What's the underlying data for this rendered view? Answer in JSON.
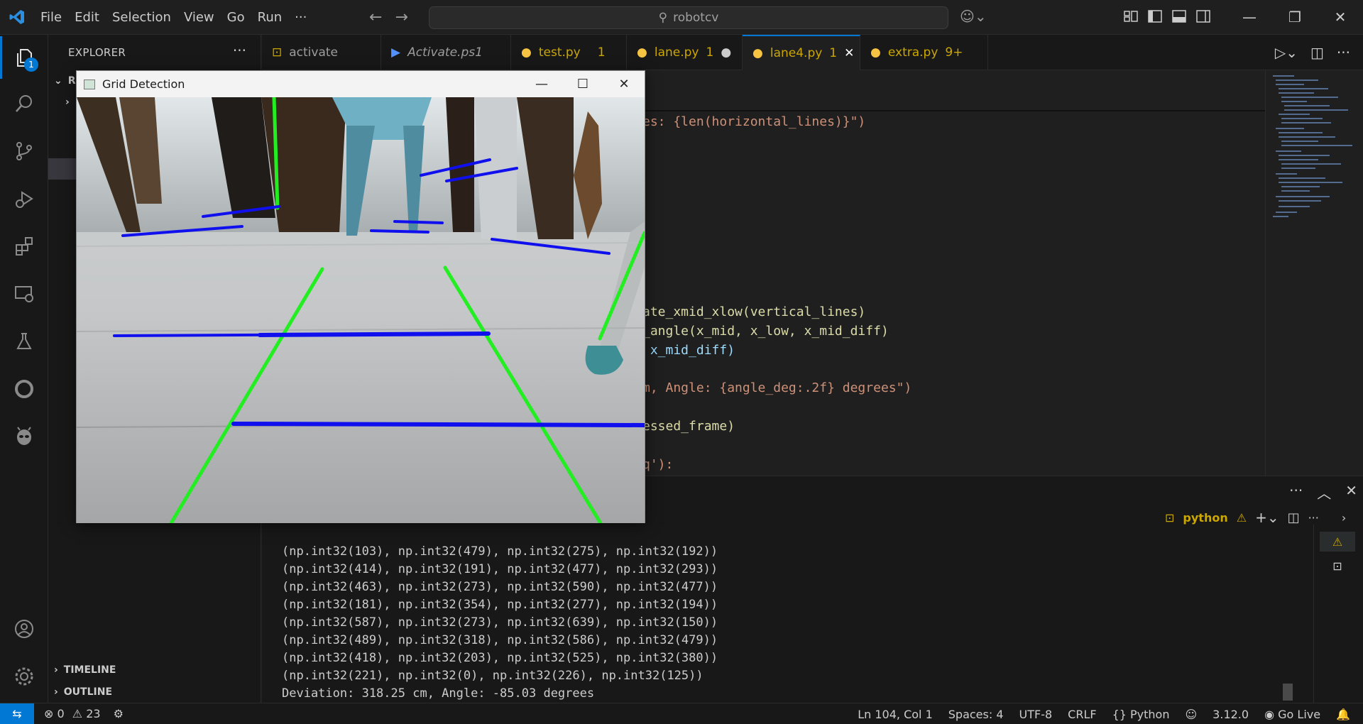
{
  "menu": [
    "File",
    "Edit",
    "Selection",
    "View",
    "Go",
    "Run",
    "···"
  ],
  "search": {
    "text": "robotcv"
  },
  "sidebar": {
    "title": "EXPLORER",
    "more": "···",
    "root_label": "R",
    "sections": [
      "TIMELINE",
      "OUTLINE"
    ]
  },
  "activity": {
    "explorer_badge": "1"
  },
  "tabs": [
    {
      "label": "activate",
      "icon": "terminal-icon",
      "badge": ""
    },
    {
      "label": "Activate.ps1",
      "icon": "powershell-icon",
      "badge": ""
    },
    {
      "label": "test.py",
      "icon": "python-icon",
      "badge": "1"
    },
    {
      "label": "lane.py",
      "icon": "python-icon",
      "badge": "1"
    },
    {
      "label": "lane4.py",
      "icon": "python-icon",
      "badge": "1"
    },
    {
      "label": "extra.py",
      "icon": "python-icon",
      "badge": "9+"
    }
  ],
  "editor": {
    "lines": [
      {
        "text": "es: {len(horizontal_lines)}\")",
        "top": 0
      },
      {
        "text": "ate_xmid_xlow(vertical_lines)",
        "top": 0
      },
      {
        "text": "_angle(x_mid, x_low, x_mid_diff)",
        "top": 0
      },
      {
        "text": " x_mid_diff)",
        "top": 0
      },
      {
        "text": "m, Angle: {angle_deg:.2f} degrees\")",
        "top": 0
      },
      {
        "text": "essed_frame)",
        "top": 0
      },
      {
        "text": "q'):",
        "top": 0
      }
    ]
  },
  "terminal": {
    "profile": "python",
    "lines": [
      "(np.int32(103), np.int32(479), np.int32(275), np.int32(192))",
      "(np.int32(414), np.int32(191), np.int32(477), np.int32(293))",
      "(np.int32(463), np.int32(273), np.int32(590), np.int32(477))",
      "(np.int32(181), np.int32(354), np.int32(277), np.int32(194))",
      "(np.int32(587), np.int32(273), np.int32(639), np.int32(150))",
      "(np.int32(489), np.int32(318), np.int32(586), np.int32(479))",
      "(np.int32(418), np.int32(203), np.int32(525), np.int32(380))",
      "(np.int32(221), np.int32(0), np.int32(226), np.int32(125))",
      "Deviation: 318.25 cm, Angle: -85.03 degrees"
    ]
  },
  "window": {
    "title": "Grid Detection"
  },
  "status": {
    "errors": "0",
    "warnings": "23",
    "position": "Ln 104, Col 1",
    "spaces": "Spaces: 4",
    "encoding": "UTF-8",
    "eol": "CRLF",
    "language": "Python",
    "python_version": "3.12.0",
    "golive": "Go Live"
  },
  "colors": {
    "accent": "#0078d4",
    "warning": "#cca700",
    "detected_vertical": "#22ee22",
    "detected_horizontal": "#1010ee"
  }
}
